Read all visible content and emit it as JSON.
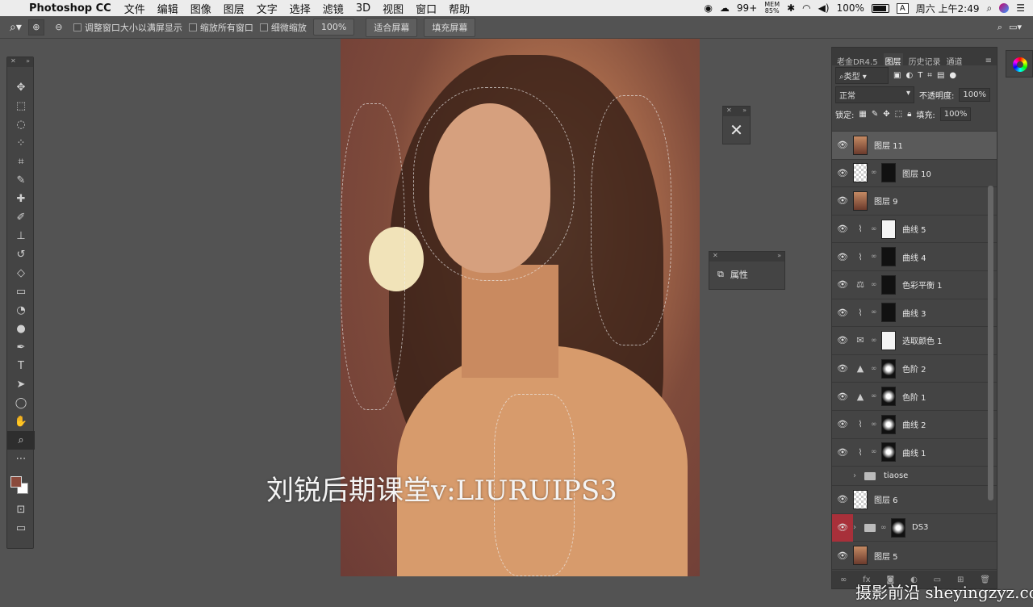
{
  "menubar": {
    "app_name": "Photoshop CC",
    "menus": [
      "文件",
      "编辑",
      "图像",
      "图层",
      "文字",
      "选择",
      "滤镜",
      "3D",
      "视图",
      "窗口",
      "帮助"
    ],
    "status": {
      "notifications": "99+",
      "mem_label": "MEM",
      "mem_value": "85%",
      "battery": "100%",
      "input_source": "A",
      "clock": "周六 上午2:49"
    }
  },
  "options_bar": {
    "checkbox_resize": "调整窗口大小以满屏显示",
    "checkbox_zoom_all": "缩放所有窗口",
    "checkbox_scrubby": "细微缩放",
    "zoom_100": "100%",
    "fit_screen": "适合屏幕",
    "fill_screen": "填充屏幕"
  },
  "canvas": {
    "watermark": "刘锐后期课堂v:LIURUIPS3"
  },
  "props_panel": {
    "label": "属性"
  },
  "layers_panel": {
    "tabs": [
      "老金DR4.5",
      "图层",
      "历史记录",
      "通道"
    ],
    "filter_kind": "类型",
    "blend_mode": "正常",
    "opacity_label": "不透明度:",
    "opacity_value": "100%",
    "lock_label": "锁定:",
    "fill_label": "填充:",
    "fill_value": "100%",
    "layers": [
      {
        "name": "图层 11",
        "kind": "photo"
      },
      {
        "name": "图层 10",
        "kind": "photo-mask"
      },
      {
        "name": "图层 9",
        "kind": "photo"
      },
      {
        "name": "曲线 5",
        "kind": "curves",
        "mask": "white"
      },
      {
        "name": "曲线 4",
        "kind": "curves",
        "mask": "black"
      },
      {
        "name": "色彩平衡 1",
        "kind": "balance",
        "mask": "black"
      },
      {
        "name": "曲线 3",
        "kind": "curves",
        "mask": "black"
      },
      {
        "name": "选取颜色 1",
        "kind": "selective",
        "mask": "white"
      },
      {
        "name": "色阶 2",
        "kind": "levels",
        "mask": "mixed"
      },
      {
        "name": "色阶 1",
        "kind": "levels",
        "mask": "mixed"
      },
      {
        "name": "曲线 2",
        "kind": "curves",
        "mask": "mixed"
      },
      {
        "name": "曲线 1",
        "kind": "curves",
        "mask": "mixed"
      },
      {
        "name": "tiaose",
        "kind": "group"
      },
      {
        "name": "图层 6",
        "kind": "empty"
      },
      {
        "name": "DS3",
        "kind": "group-mask"
      },
      {
        "name": "图层 5",
        "kind": "photo"
      }
    ]
  },
  "site_watermark": "摄影前沿 sheyingzyz.com",
  "colors": {
    "foreground_swatch": "#8a4a3c",
    "background_swatch": "#ffffff"
  }
}
